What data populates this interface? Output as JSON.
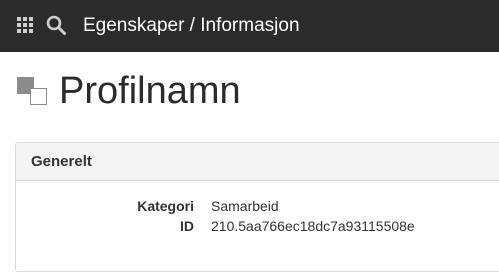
{
  "topbar": {
    "title": "Egenskaper / Informasjon",
    "icons": [
      "apps-grid-icon",
      "search-icon"
    ],
    "background": "#2b2b2b"
  },
  "page": {
    "title": "Profilnamn",
    "icon": "profile-icon"
  },
  "panel": {
    "header": "Generelt",
    "fields": [
      {
        "label": "Kategori",
        "value": "Samarbeid"
      },
      {
        "label": "ID",
        "value": "210.5aa766ec18dc7a93115508e"
      }
    ]
  }
}
